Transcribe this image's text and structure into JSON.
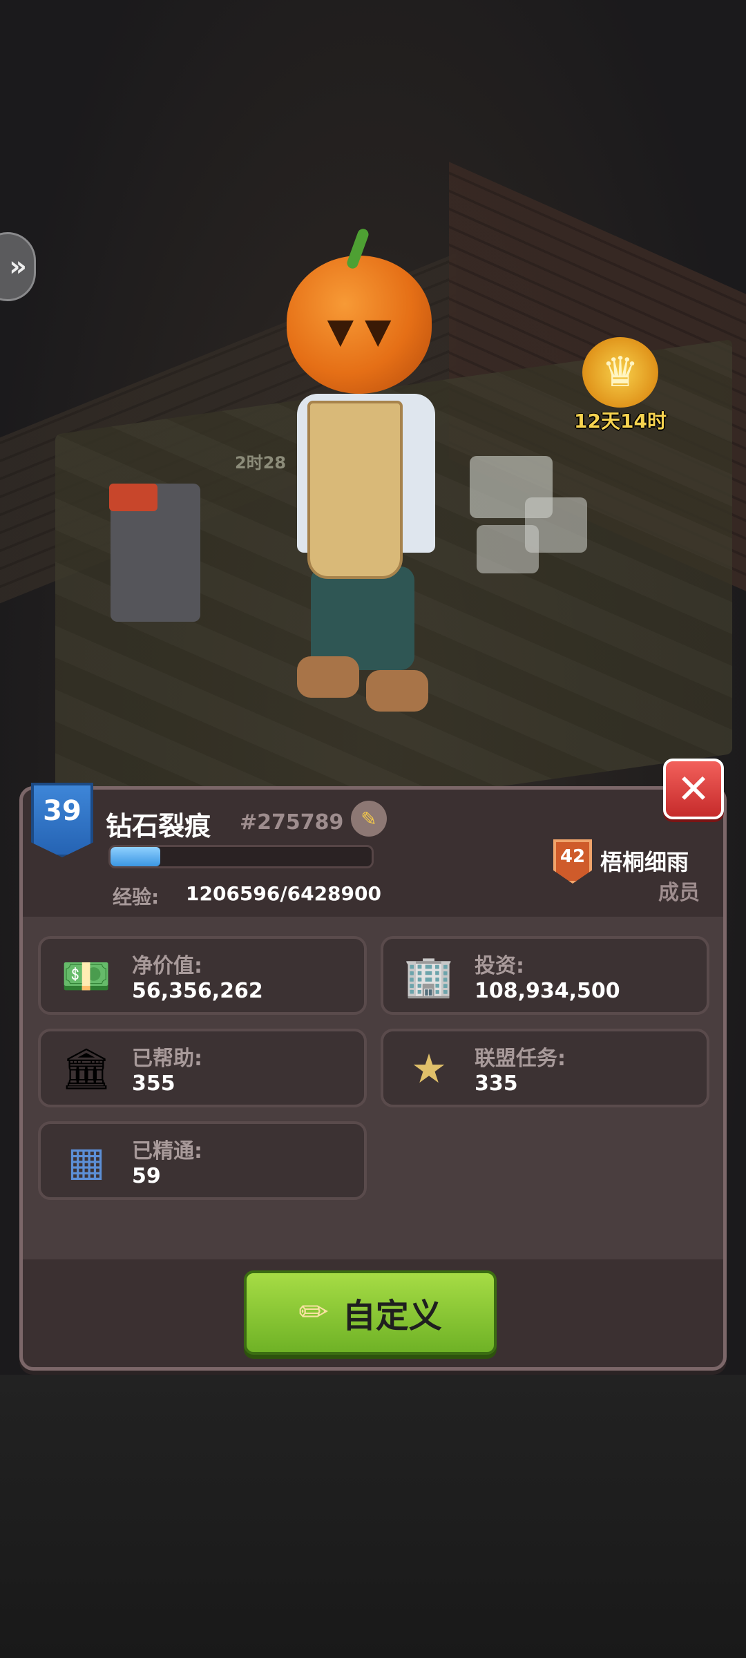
{
  "scene": {
    "event_timer": "12天14时",
    "small_timer": "2时28"
  },
  "profile": {
    "level": "39",
    "name": "钻石裂痕",
    "id": "#275789",
    "xp_label": "经验:",
    "xp_value": "1206596/6428900",
    "xp_fraction": 0.19
  },
  "alliance": {
    "level": "42",
    "name": "梧桐细雨",
    "role": "成员"
  },
  "stats": [
    {
      "label": "净价值:",
      "value": "56,356,262",
      "icon": "cash-stack-icon"
    },
    {
      "label": "投资:",
      "value": "108,934,500",
      "icon": "building-icon"
    },
    {
      "label": "已帮助:",
      "value": "355",
      "icon": "heart-bank-icon"
    },
    {
      "label": "联盟任务:",
      "value": "335",
      "icon": "sheriff-star-icon"
    },
    {
      "label": "已精通:",
      "value": "59",
      "icon": "blueprint-icon"
    }
  ],
  "actions": {
    "customize_label": "自定义"
  },
  "colors": {
    "panel": "#4a3e3f",
    "accent_green": "#8cc63f",
    "close_red": "#e04545",
    "level_blue": "#2f73c6"
  }
}
